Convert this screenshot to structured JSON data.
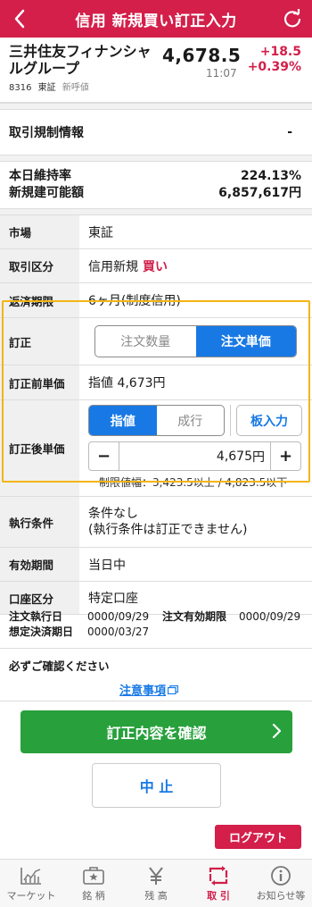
{
  "header": {
    "title": "信用 新規買い訂正入力"
  },
  "stock": {
    "name": "三井住友フィナンシャルグループ",
    "code": "8316",
    "market": "東証",
    "tag": "新呼値",
    "price": "4,678.5",
    "time": "11:07",
    "change": "+18.5",
    "change_pct": "+0.39%"
  },
  "regulation": {
    "label": "取引規制情報",
    "value": "-"
  },
  "margin": {
    "rate_label": "本日維持率",
    "rate_value": "224.13%",
    "limit_label": "新規建可能額",
    "limit_value": "6,857,617円"
  },
  "form": {
    "market": {
      "label": "市場",
      "value": "東証"
    },
    "trade": {
      "label": "取引区分",
      "value": "信用新規",
      "side": "買い"
    },
    "repay": {
      "label": "返済期限",
      "value": "6ヶ月(制度信用)"
    },
    "correction": {
      "label": "訂正",
      "options": [
        "注文数量",
        "注文単価"
      ],
      "selected": "注文単価"
    },
    "before_price": {
      "label": "訂正前単価",
      "value": "指値 4,673円"
    },
    "after_price": {
      "label": "訂正後単価",
      "options": [
        "指値",
        "成行"
      ],
      "selected": "指値",
      "board_button": "板入力",
      "minus": "−",
      "plus": "+",
      "input_value": "4,675",
      "unit": "円",
      "limit_text": "制限値幅：3,423.5以上 / 4,823.5以下"
    },
    "exec": {
      "label": "執行条件",
      "line1": "条件なし",
      "line2": "(執行条件は訂正できません)"
    },
    "validity": {
      "label": "有効期間",
      "value": "当日中"
    },
    "account": {
      "label": "口座区分",
      "value": "特定口座"
    }
  },
  "dates": {
    "exec_label": "注文執行日",
    "exec_value": "0000/09/29",
    "valid_label": "注文有効期限",
    "valid_value": "0000/09/29",
    "settle_label": "想定決済期日",
    "settle_value": "0000/03/27"
  },
  "notice": {
    "title": "必ずご確認ください",
    "link": "注意事項"
  },
  "buttons": {
    "confirm": "訂正内容を確認",
    "cancel": "中 止",
    "logout": "ログアウト"
  },
  "tabs": [
    {
      "label": "マーケット",
      "icon": "chart-icon"
    },
    {
      "label": "銘 柄",
      "icon": "briefcase-star-icon"
    },
    {
      "label": "残 高",
      "icon": "yen-icon"
    },
    {
      "label": "取 引",
      "icon": "trade-arrows-icon"
    },
    {
      "label": "お知らせ等",
      "icon": "info-icon"
    }
  ],
  "colors": {
    "brand": "#d31f4a",
    "accent": "#1879e5",
    "confirm": "#28a03c",
    "highlight": "#f3b516"
  }
}
